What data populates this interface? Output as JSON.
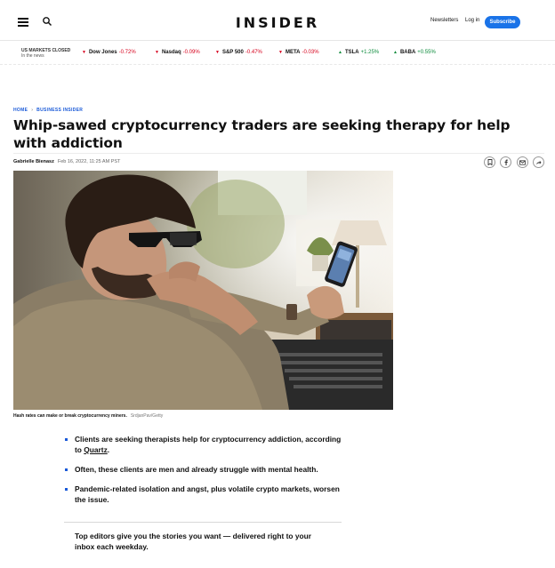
{
  "header": {
    "logo": "INSIDER",
    "newsletters": "Newsletters",
    "login": "Log in",
    "subscribe": "Subscribe"
  },
  "ticker": {
    "status_title": "US MARKETS CLOSED",
    "status_sub": "In the news",
    "items": [
      {
        "symbol": "Dow Jones",
        "change": "-0.72%",
        "direction": "down"
      },
      {
        "symbol": "Nasdaq",
        "change": "-0.09%",
        "direction": "down"
      },
      {
        "symbol": "S&P 500",
        "change": "-0.47%",
        "direction": "down"
      },
      {
        "symbol": "META",
        "change": "-0.03%",
        "direction": "down"
      },
      {
        "symbol": "TSLA",
        "change": "+1.25%",
        "direction": "up"
      },
      {
        "symbol": "BABA",
        "change": "+0.55%",
        "direction": "up"
      }
    ]
  },
  "article": {
    "breadcrumb": [
      "HOME",
      "BUSINESS INSIDER"
    ],
    "headline": "Whip-sawed cryptocurrency traders are seeking therapy for help with addiction",
    "author": "Gabrielle Bienasz",
    "date": "Feb 16, 2022, 11:25 AM PST",
    "caption": "Hash rates can make or break cryptocurrency miners.",
    "credit": "SrdjanPav/Getty",
    "bullets": [
      {
        "pre": "Clients are seeking therapists help for cryptocurrency addiction, according to ",
        "link": "Quartz",
        "post": "."
      },
      {
        "text": "Often, these clients are men and already struggle with mental health."
      },
      {
        "text": "Pandemic-related isolation and angst, plus volatile crypto markets, worsen the issue."
      }
    ],
    "promo": "Top editors give you the stories you want — delivered right to your inbox each weekday."
  },
  "colors": {
    "accent": "#1a73e8",
    "down": "#d6001c",
    "up": "#0a8a3a",
    "link": "#1a5ad8"
  }
}
